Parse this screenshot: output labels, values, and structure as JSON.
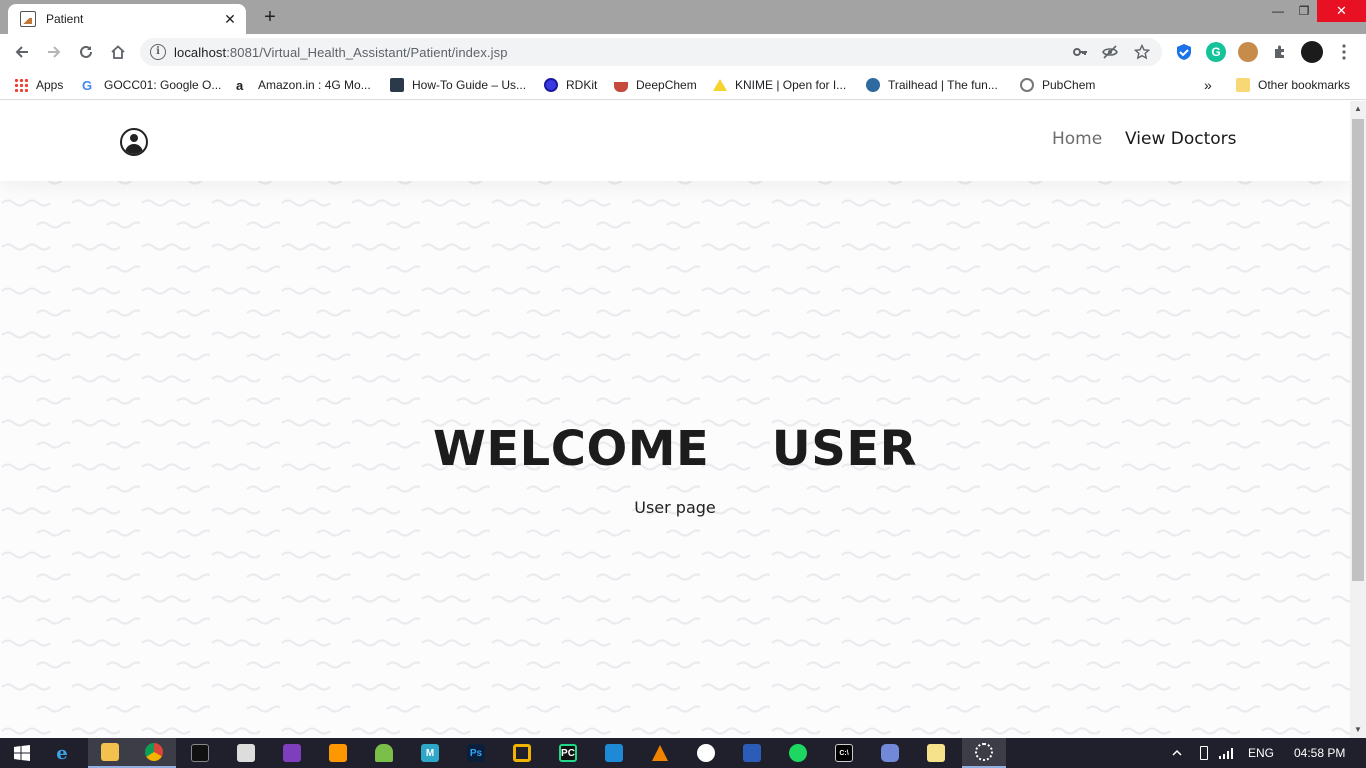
{
  "browser": {
    "tab": {
      "title": "Patient",
      "close": "✕"
    },
    "new_tab": "+",
    "window_controls": {
      "minimize": "—",
      "maximize": "❐",
      "close": "✕"
    },
    "url": {
      "host": "localhost",
      "rest": ":8081/Virtual_Health_Assistant/Patient/index.jsp"
    },
    "bookmarks": [
      {
        "label": "Apps",
        "icon": "apps-grid-icon"
      },
      {
        "label": "GOCC01: Google O...",
        "icon": "google-icon"
      },
      {
        "label": "Amazon.in : 4G Mo...",
        "icon": "amazon-icon"
      },
      {
        "label": "How-To Guide – Us...",
        "icon": "guide-icon"
      },
      {
        "label": "RDKit",
        "icon": "rdkit-icon"
      },
      {
        "label": "DeepChem",
        "icon": "deepchem-icon"
      },
      {
        "label": "KNIME | Open for I...",
        "icon": "knime-icon"
      },
      {
        "label": "Trailhead | The fun...",
        "icon": "trailhead-icon"
      },
      {
        "label": "PubChem",
        "icon": "pubchem-icon"
      }
    ],
    "bookmarks_overflow": "»",
    "other_bookmarks": "Other bookmarks"
  },
  "site": {
    "nav": {
      "home": "Home",
      "view_doctors": "View Doctors"
    },
    "hero": {
      "title": "WELCOME  USER",
      "subtitle": "User page"
    }
  },
  "taskbar": {
    "language": "ENG",
    "time": "04:58 PM"
  },
  "colors": {
    "tabstrip": "#a3a3a3",
    "close_red": "#e81123",
    "taskbar": "#20202d"
  }
}
